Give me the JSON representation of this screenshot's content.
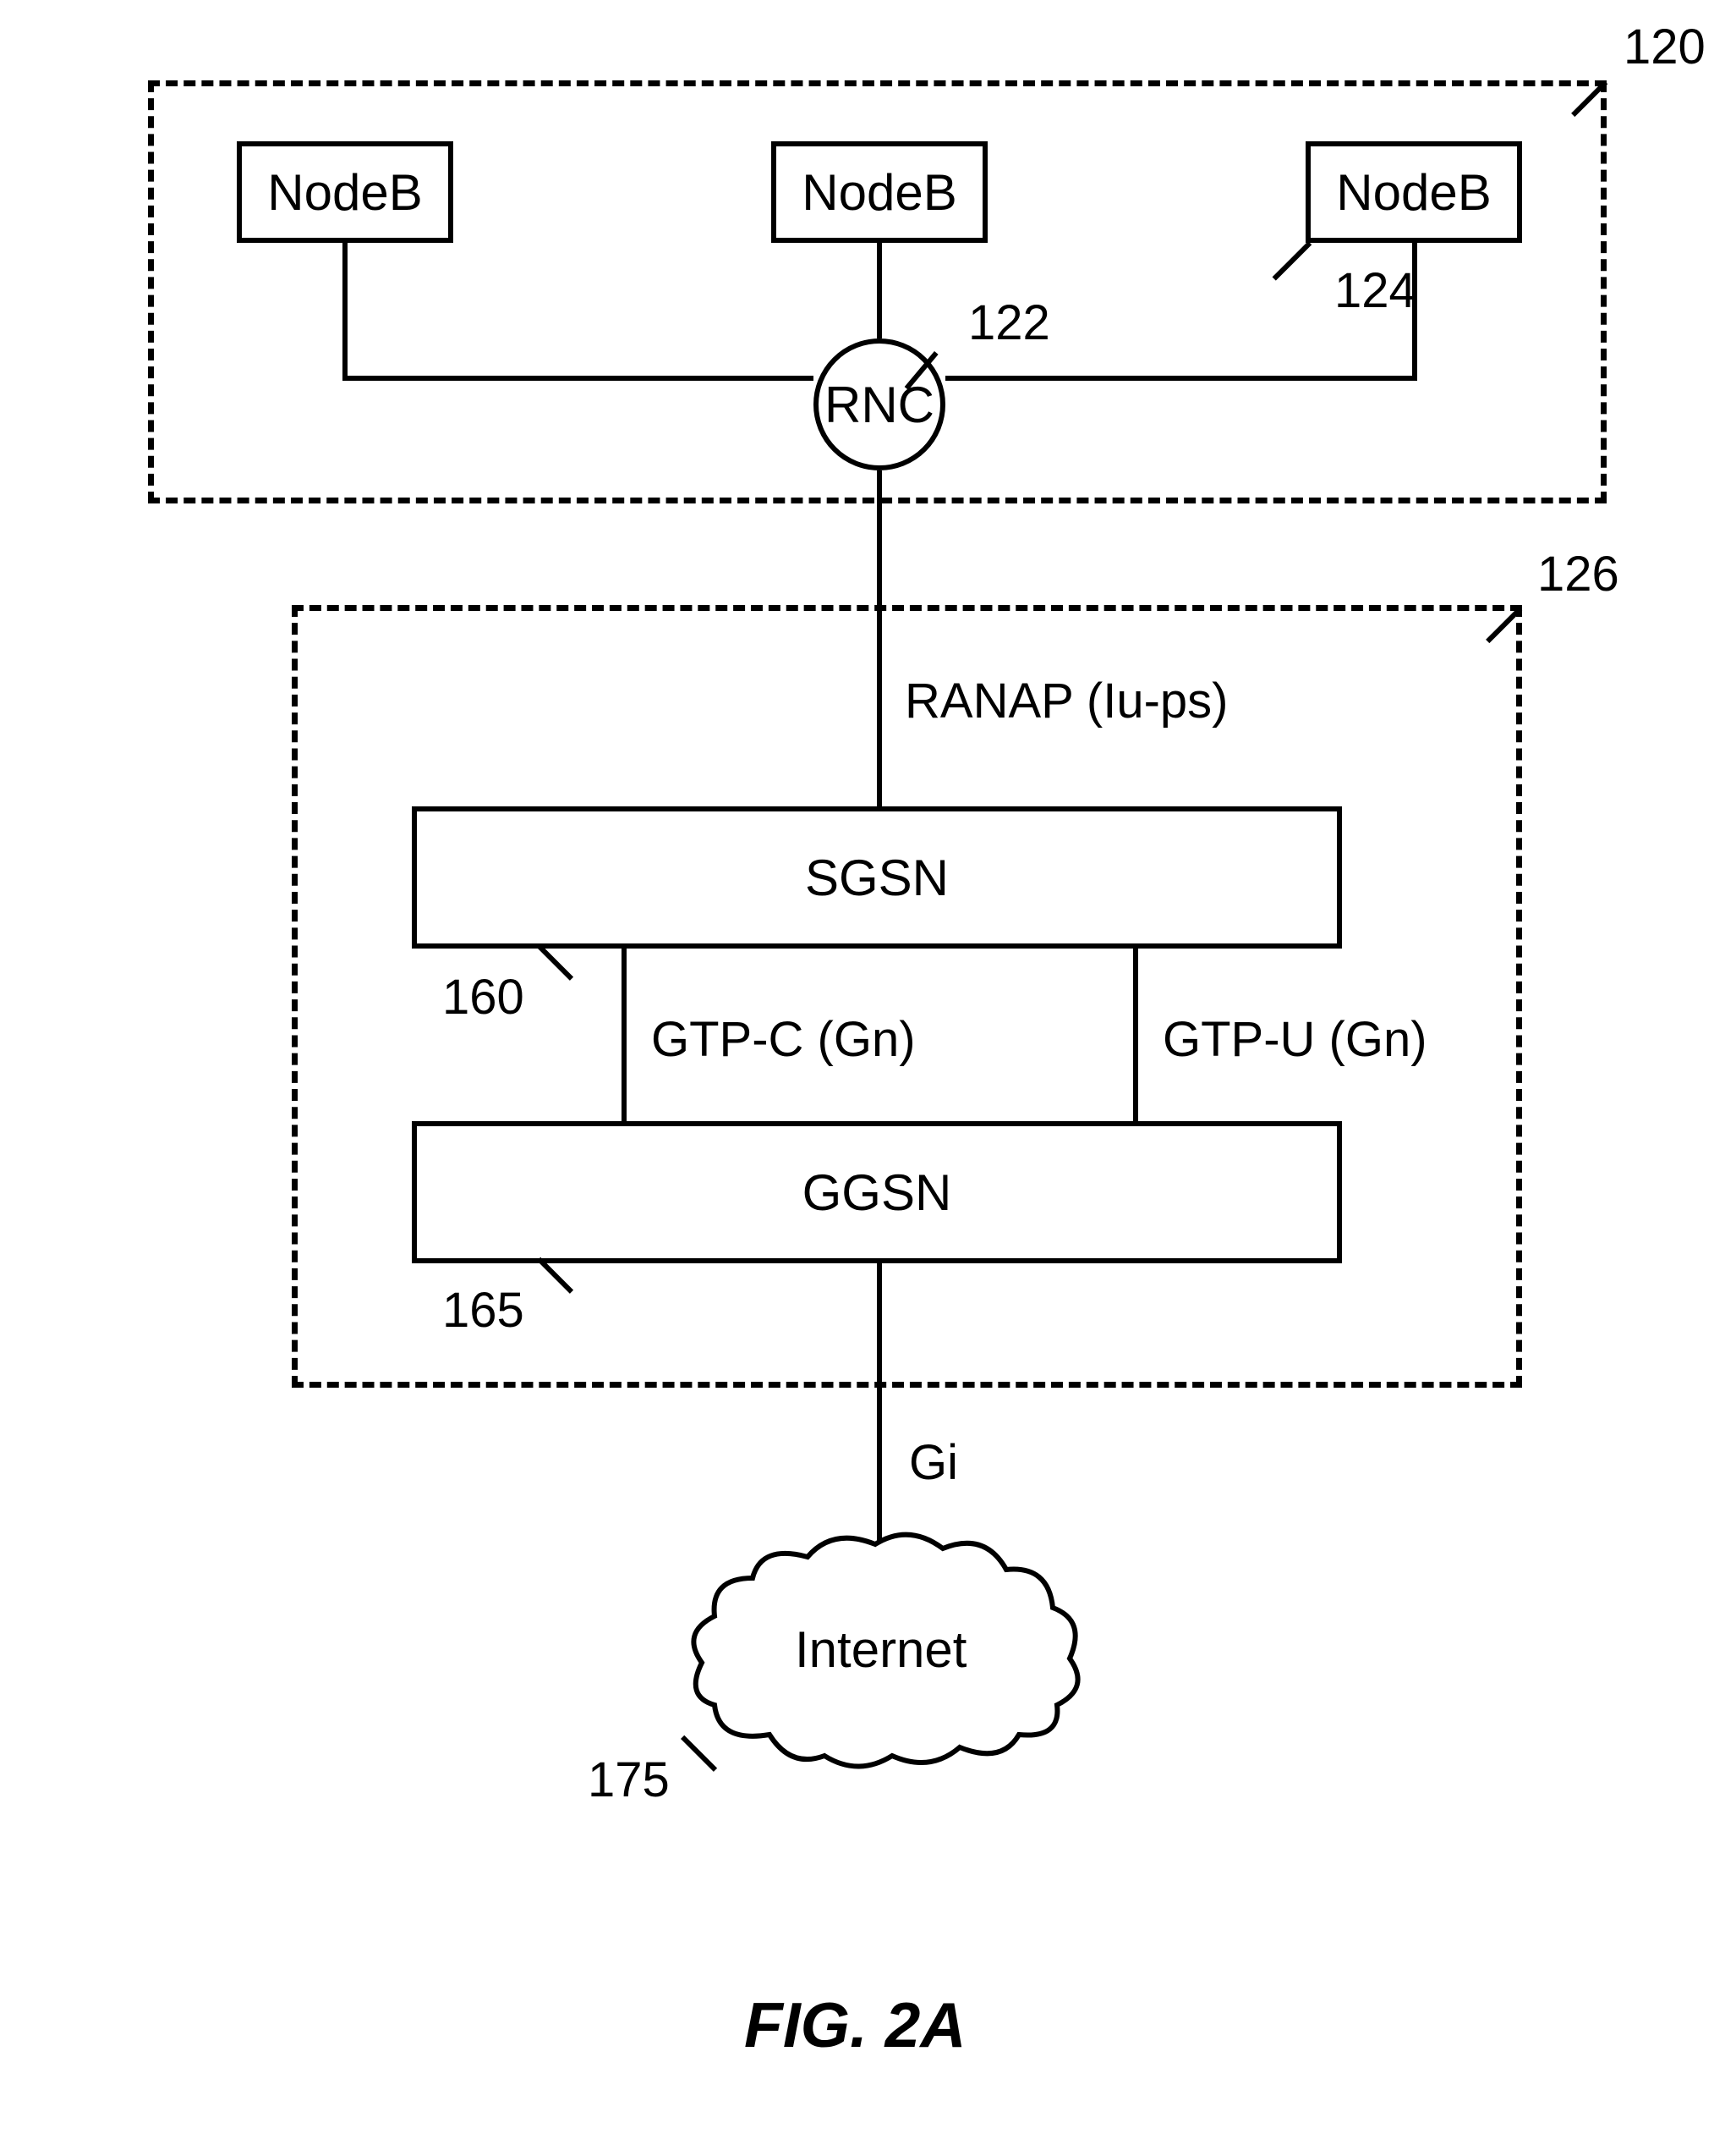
{
  "refnums": {
    "outer_ran": "120",
    "rnc": "122",
    "nodeb_right": "124",
    "outer_core": "126",
    "sgsn": "160",
    "ggsn": "165",
    "internet": "175"
  },
  "nodes": {
    "nodeb1": "NodeB",
    "nodeb2": "NodeB",
    "nodeb3": "NodeB",
    "rnc": "RNC",
    "sgsn": "SGSN",
    "ggsn": "GGSN",
    "internet": "Internet"
  },
  "links": {
    "ranap": "RANAP (Iu-ps)",
    "gtpc": "GTP-C (Gn)",
    "gtpu": "GTP-U (Gn)",
    "gi": "Gi"
  },
  "caption": "FIG. 2A"
}
